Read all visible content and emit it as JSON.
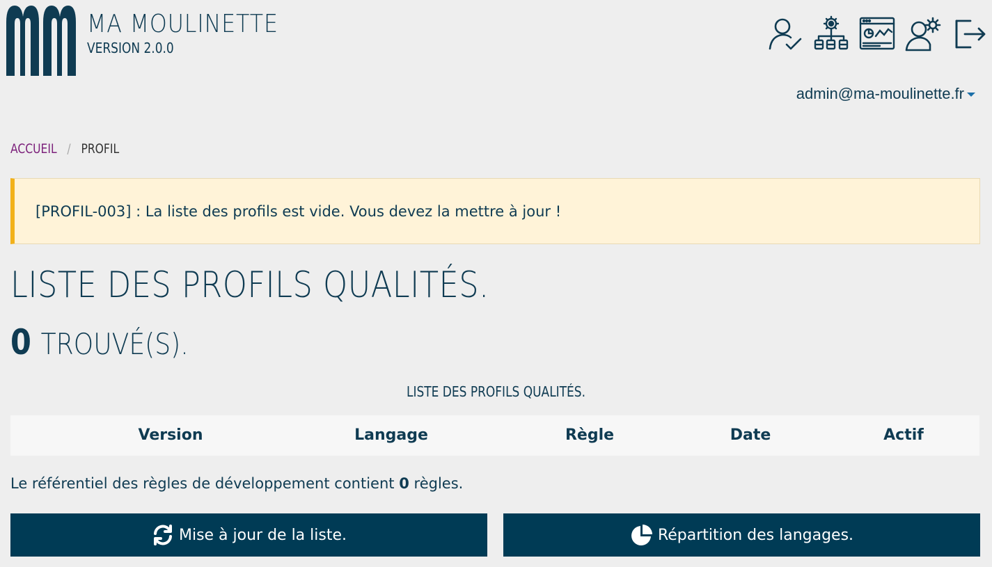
{
  "app": {
    "name": "MA MOULINETTE",
    "version": "VERSION 2.0.0"
  },
  "header": {
    "icons": [
      "user-check-icon",
      "network-settings-icon",
      "dashboard-window-icon",
      "user-gear-icon",
      "logout-icon"
    ],
    "user_email": "admin@ma-moulinette.fr"
  },
  "breadcrumb": {
    "home": "ACCUEIL",
    "separator": "/",
    "current": "PROFIL"
  },
  "alert": {
    "message": "[PROFIL-003] : La liste des profils est vide. Vous devez la mettre à jour !"
  },
  "main": {
    "title": "LISTE DES PROFILS QUALITÉS.",
    "count": "0",
    "found_label": "TROUVÉ(S).",
    "table_caption": "LISTE DES PROFILS QUALITÉS.",
    "columns": [
      "Version",
      "Langage",
      "Règle",
      "Date",
      "Actif"
    ],
    "rows": [],
    "ref_prefix": "Le référentiel des règles de développement contient",
    "ref_count": "0",
    "ref_suffix": "règles."
  },
  "buttons": {
    "update_label": "Mise à jour de la liste.",
    "repartition_label": "Répartition des langages."
  },
  "colors": {
    "primary": "#003b55",
    "text": "#0f3b52",
    "alert_bg": "#fff3d8",
    "alert_border": "#f2b11a",
    "breadcrumb_link": "#7b1f7a",
    "background": "#eeeeee"
  }
}
